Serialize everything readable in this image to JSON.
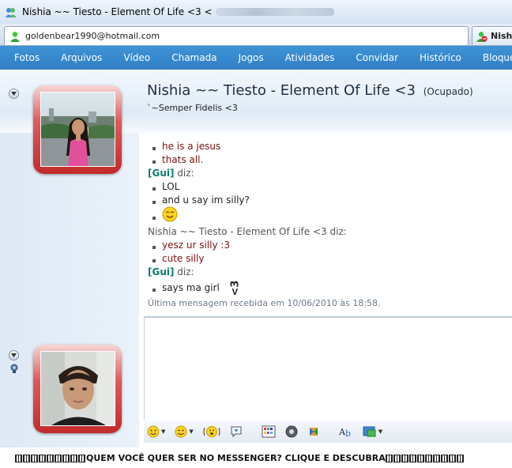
{
  "window": {
    "title": "Nishia ~~ Tiesto - Element Of Life <3 <"
  },
  "tabs": {
    "active_email": "goldenbear1990@hotmail.com",
    "other_label": "Nishi"
  },
  "menu": [
    "Fotos",
    "Arquivos",
    "Vídeo",
    "Chamada",
    "Jogos",
    "Atividades",
    "Convidar",
    "Histórico",
    "Bloquear"
  ],
  "contact": {
    "name": "Nishia ~~ Tiesto - Element Of Life <3",
    "status": "(Ocupado)",
    "personal_message": "`~Semper Fidelis <3"
  },
  "chat": {
    "lines": [
      {
        "type": "msg",
        "text": "he is a jesus",
        "style": "red"
      },
      {
        "type": "msg",
        "text": "thats all.",
        "style": "red"
      },
      {
        "type": "speaker",
        "name": "[Gui]",
        "suffix": " diz:"
      },
      {
        "type": "msg",
        "text": "LOL",
        "style": "dark"
      },
      {
        "type": "msg",
        "text": "and u say im silly?",
        "style": "dark"
      },
      {
        "type": "emoticon",
        "icon": "smile-emoticon-icon"
      },
      {
        "type": "speaker",
        "name": "Nishia ~~ Tiesto - Element Of Life <3",
        "suffix": " diz:",
        "plain": true
      },
      {
        "type": "msg",
        "text": "yesz ur silly :3",
        "style": "red"
      },
      {
        "type": "msg",
        "text": "cute silly",
        "style": "red"
      },
      {
        "type": "speaker",
        "name": "[Gui]",
        "suffix": " diz:"
      },
      {
        "type": "msg",
        "text": "says ma girl",
        "style": "dark",
        "trail": "<3"
      }
    ],
    "last_received": "Última mensagem recebida em 10/06/2010 às 18:58."
  },
  "colors": {
    "menubar": "#3e93d6",
    "incoming_text": "#7a1010",
    "speaker_name": "#0b7a6a",
    "avatar_frame": "#d33a3a"
  },
  "toolbar_icons": [
    "emoticon-icon",
    "wink-icon",
    "nudge-icon",
    "voice-clip-icon",
    "background-icon",
    "ink-icon",
    "gift-icon",
    "font-icon",
    "wink-game-icon"
  ],
  "ad": {
    "text": "QUEM VOCÊ QUER SER NO MESSENGER? CLIQUE E DESCUBRA"
  }
}
